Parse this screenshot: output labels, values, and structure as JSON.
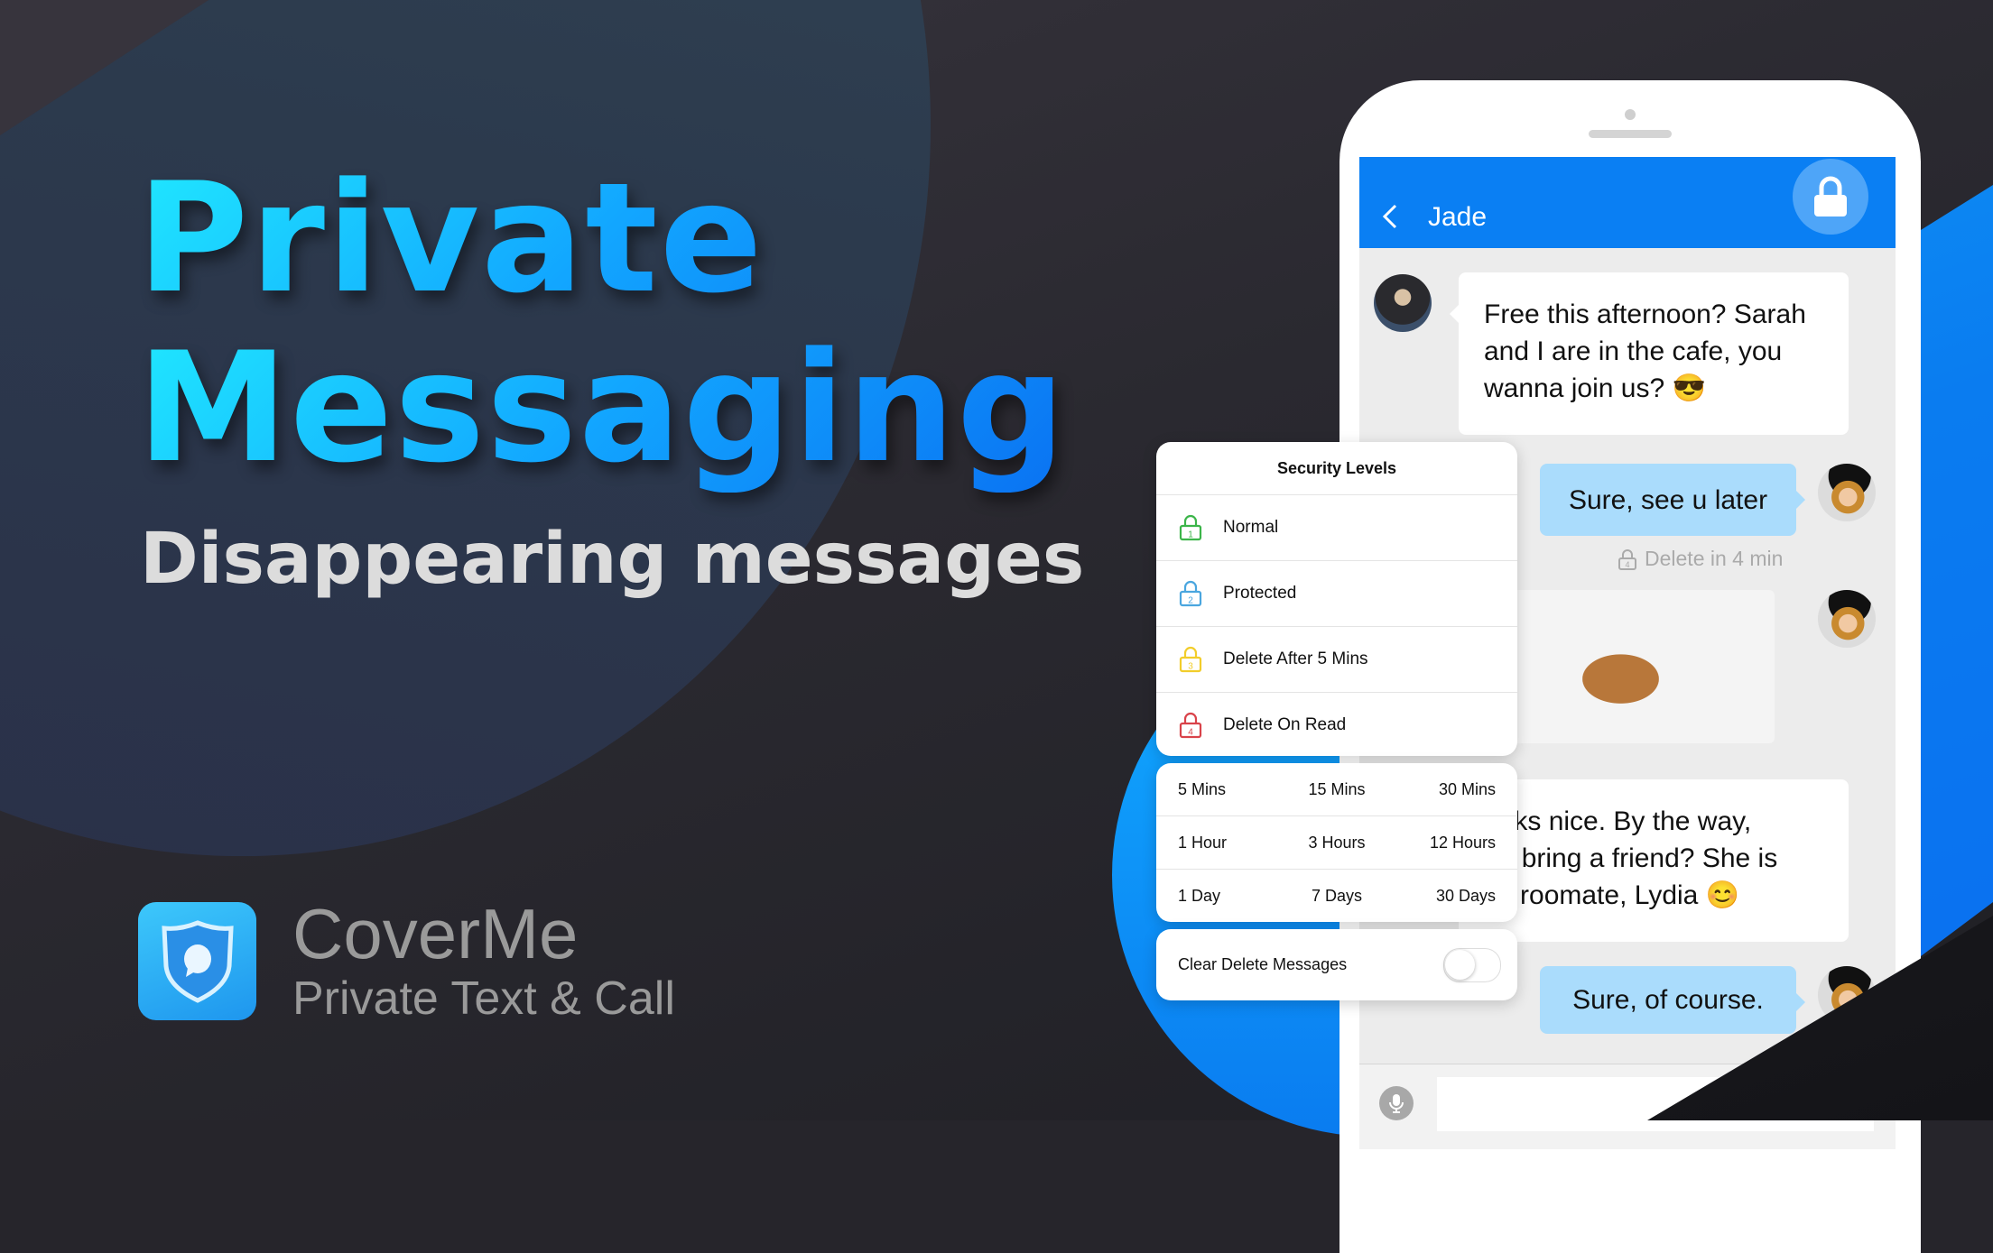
{
  "headline": {
    "line1": "Private",
    "line2": "Messaging"
  },
  "subheadline": "Disappearing messages",
  "brand": {
    "name": "CoverMe",
    "tagline": "Private Text & Call",
    "icon": "shield-chat-icon",
    "color": "#1e96ee"
  },
  "chat": {
    "contact_name": "Jade",
    "back_icon": "chevron-left-icon",
    "lock_icon": "lock-icon",
    "header_color": "#0a7ff3",
    "messages": [
      {
        "direction": "incoming",
        "text_lines": [
          "Free this afternoon? Sarah",
          "and I are in the cafe, you",
          "wanna join us? 😎"
        ]
      },
      {
        "direction": "outgoing",
        "text": "Sure, see u later",
        "status": "Delete in 4 min",
        "status_level": "4"
      },
      {
        "direction": "outgoing",
        "type": "image",
        "alt": "latte art coffee photo"
      },
      {
        "direction": "incoming",
        "text_lines": [
          "ooks nice. By the way,",
          "n I bring a friend? She is",
          "ny roomate, Lydia 😊"
        ]
      },
      {
        "direction": "outgoing",
        "text": "Sure, of course."
      }
    ],
    "input": {
      "placeholder": "",
      "mic_icon": "microphone-icon"
    }
  },
  "security_levels": {
    "title": "Security Levels",
    "items": [
      {
        "label": "Normal",
        "level": "1",
        "color": "#3cb54a"
      },
      {
        "label": "Protected",
        "level": "2",
        "color": "#4aa6df"
      },
      {
        "label": "Delete After 5 Mins",
        "level": "3",
        "color": "#f2cd2b"
      },
      {
        "label": "Delete On Read",
        "level": "4",
        "color": "#d9434a"
      }
    ]
  },
  "timers": [
    [
      "5 Mins",
      "15 Mins",
      "30 Mins"
    ],
    [
      "1 Hour",
      "3 Hours",
      "12 Hours"
    ],
    [
      "1 Day",
      "7 Days",
      "30 Days"
    ]
  ],
  "clear_delete": {
    "label": "Clear Delete Messages",
    "enabled": false
  }
}
